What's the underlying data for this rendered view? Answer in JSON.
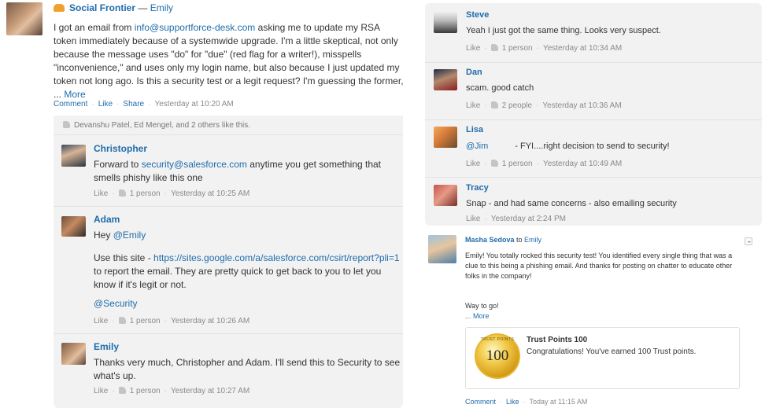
{
  "main_post": {
    "group": "Social Frontier",
    "separator": " — ",
    "author": "Emily",
    "body_part1": "I got an email from ",
    "body_link": "info@supportforce-desk.com",
    "body_part2": " asking me to update my RSA token immediately because of a systemwide upgrade. I'm a little skeptical, not only because the message uses \"do\" for \"due\" (red flag for a writer!), misspells \"inconvenience,\" and uses only my login name, but also because I just updated my token not long ago. Is this a security test or a legit request? I'm guessing the former, ... ",
    "more_link": "More",
    "actions": {
      "comment": "Comment",
      "like": "Like",
      "share": "Share",
      "time": "Yesterday at 10:20 AM"
    },
    "likes_line": "Devanshu Patel, Ed Mengel, and 2 others like this."
  },
  "comments_left": [
    {
      "name": "Christopher",
      "text_part1": "Forward to ",
      "text_link": "security@salesforce.com",
      "text_part2": " anytime you get something that smells phishy like this one",
      "like": "Like",
      "count": "1 person",
      "time": "Yesterday at 10:25 AM"
    },
    {
      "name": "Adam",
      "line1_pre": "Hey ",
      "line1_mention": "@Emily",
      "line2_pre": "Use this site - ",
      "line2_link": "https://sites.google.com/a/salesforce.com/csirt/report?pli=1",
      "line2_post": " to report the email. They are pretty quick to get back to you to let you know if it's legit or not.",
      "line3_mention": "@Security",
      "like": "Like",
      "count": "1 person",
      "time": "Yesterday at 10:26 AM"
    },
    {
      "name": "Emily",
      "text": "Thanks very much, Christopher and Adam. I'll send this to Security to see what's up.",
      "like": "Like",
      "count": "1 person",
      "time": "Yesterday at 10:27 AM"
    }
  ],
  "comments_right": [
    {
      "name": "Steve",
      "text": "Yeah I just got the same thing. Looks very suspect.",
      "like": "Like",
      "count": "1 person",
      "time": "Yesterday at 10:34 AM"
    },
    {
      "name": "Dan",
      "text": "scam. good catch",
      "like": "Like",
      "count": "2 people",
      "time": "Yesterday at 10:36 AM"
    },
    {
      "name": "Lisa",
      "mention": "@Jim",
      "text": "- FYI....right decision to send to security!",
      "like": "Like",
      "count": "1 person",
      "time": "Yesterday at 10:49 AM"
    },
    {
      "name": "Tracy",
      "text": "Snap - and had same concerns - also emailing security",
      "like": "Like",
      "time": "Yesterday at 2:24 PM"
    }
  ],
  "second_post": {
    "author": "Masha Sedova",
    "to_word": " to ",
    "recipient": "Emily",
    "body": "Emily! You totally rocked this security test! You identified every single thing that was a clue to this being a phishing email. And thanks for posting on chatter to educate other folks in the company!",
    "closing": "Way to go!",
    "more_link": "... More",
    "trust": {
      "badge_number": "100",
      "badge_ring": "TRUST POINTS",
      "title": "Trust Points 100",
      "text": "Congratulations! You've earned 100 Trust points."
    },
    "actions": {
      "comment": "Comment",
      "like": "Like",
      "time": "Today at 11:15 AM"
    }
  },
  "colors": {
    "link": "#1f6cab",
    "muted": "#8a8a8a",
    "panel": "#f2f2f2",
    "group_icon": "#f0a030"
  }
}
